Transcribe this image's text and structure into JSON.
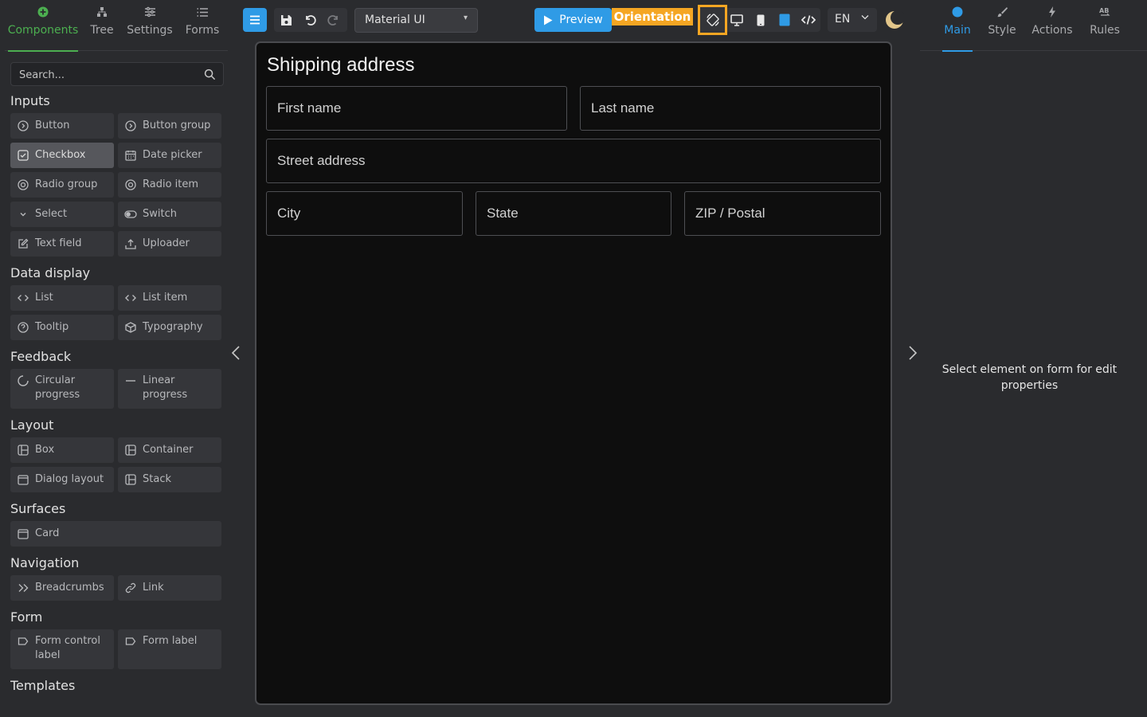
{
  "left_panel": {
    "tabs": [
      {
        "label": "Components",
        "icon": "plus-circle-icon",
        "active": true
      },
      {
        "label": "Tree",
        "icon": "tree-icon"
      },
      {
        "label": "Settings",
        "icon": "sliders-icon"
      },
      {
        "label": "Forms",
        "icon": "list-icon"
      }
    ],
    "search": {
      "placeholder": "Search..."
    },
    "sections": {
      "inputs": {
        "title": "Inputs",
        "items": [
          {
            "label": "Button",
            "icon": "button-icon"
          },
          {
            "label": "Button group",
            "icon": "button-icon"
          },
          {
            "label": "Checkbox",
            "icon": "checkbox-icon",
            "selected": true
          },
          {
            "label": "Date picker",
            "icon": "calendar-icon"
          },
          {
            "label": "Radio group",
            "icon": "radio-icon"
          },
          {
            "label": "Radio item",
            "icon": "radio-icon"
          },
          {
            "label": "Select",
            "icon": "chevron-down-icon"
          },
          {
            "label": "Switch",
            "icon": "toggle-icon"
          },
          {
            "label": "Text field",
            "icon": "edit-icon"
          },
          {
            "label": "Uploader",
            "icon": "upload-icon"
          }
        ]
      },
      "data_display": {
        "title": "Data display",
        "items": [
          {
            "label": "List",
            "icon": "code-icon"
          },
          {
            "label": "List item",
            "icon": "code-icon"
          },
          {
            "label": "Tooltip",
            "icon": "help-circle-icon"
          },
          {
            "label": "Typography",
            "icon": "cube-icon"
          }
        ]
      },
      "feedback": {
        "title": "Feedback",
        "items": [
          {
            "label": "Circular progress",
            "icon": "circular-progress-icon"
          },
          {
            "label": "Linear progress",
            "icon": "minus-icon"
          }
        ]
      },
      "layout": {
        "title": "Layout",
        "items": [
          {
            "label": "Box",
            "icon": "layout-icon"
          },
          {
            "label": "Container",
            "icon": "layout-icon"
          },
          {
            "label": "Dialog layout",
            "icon": "window-icon"
          },
          {
            "label": "Stack",
            "icon": "layout-icon"
          }
        ]
      },
      "surfaces": {
        "title": "Surfaces",
        "items": [
          {
            "label": "Card",
            "icon": "window-icon"
          }
        ]
      },
      "navigation": {
        "title": "Navigation",
        "items": [
          {
            "label": "Breadcrumbs",
            "icon": "double-chevron-icon"
          },
          {
            "label": "Link",
            "icon": "link-icon"
          }
        ]
      },
      "form": {
        "title": "Form",
        "items": [
          {
            "label": "Form control label",
            "icon": "tag-icon"
          },
          {
            "label": "Form label",
            "icon": "tag-icon"
          }
        ]
      },
      "templates": {
        "title": "Templates"
      }
    }
  },
  "toolbar": {
    "ui_library": "Material UI",
    "preview_label": "Preview",
    "orientation_tooltip": "Orientation",
    "language": "EN",
    "accent": "#2f9be6",
    "highlight": "#f5a623"
  },
  "form": {
    "title": "Shipping address",
    "fields": {
      "first_name": "First name",
      "last_name": "Last name",
      "street": "Street address",
      "city": "City",
      "state": "State",
      "zip": "ZIP / Postal"
    }
  },
  "right_panel": {
    "tabs": [
      {
        "label": "Main",
        "icon": "circle-icon",
        "active": true
      },
      {
        "label": "Style",
        "icon": "brush-icon"
      },
      {
        "label": "Actions",
        "icon": "bolt-icon"
      },
      {
        "label": "Rules",
        "icon": "ab-icon"
      }
    ],
    "hint": "Select element on form for edit properties"
  }
}
